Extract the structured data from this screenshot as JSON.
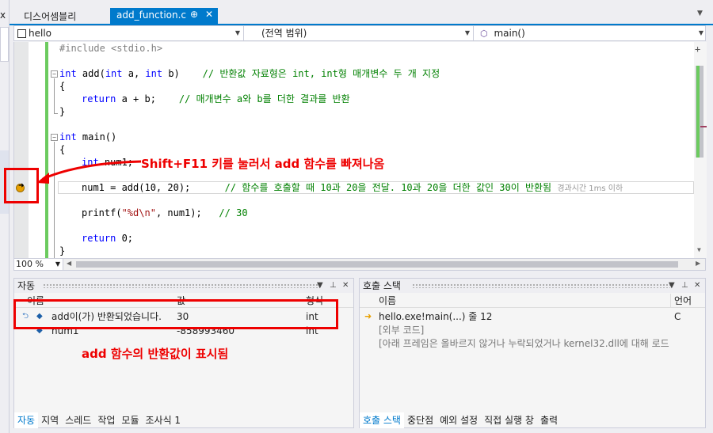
{
  "tabs": {
    "disassembly": "디스어셈블리",
    "active": "add_function.c",
    "pin_glyph": "⊕",
    "close_glyph": "✕"
  },
  "navbar": {
    "project": "hello",
    "scope": "(전역 범위)",
    "function": "main()"
  },
  "code": {
    "l1": "#include <stdio.h>",
    "l3a": "int",
    "l3b": " add(",
    "l3c": "int",
    "l3d": " a, ",
    "l3e": "int",
    "l3f": " b)    ",
    "l3g": "// 반환값 자료형은 int, int형 매개변수 두 개 지정",
    "l4": "{",
    "l5a": "return",
    "l5b": " a + b;    ",
    "l5c": "// 매개변수 a와 b를 더한 결과를 반환",
    "l6": "}",
    "l8a": "int",
    "l8b": " main()",
    "l9": "{",
    "l10a": "int",
    "l10b": " num1;",
    "l12a": "num1 = add(10, 20);      ",
    "l12b": "// 함수를 호출할 때 10과 20을 전달. 10과 20을 더한 값인 30이 반환됨",
    "l12hint": "경과시간 1ms 이하",
    "l14a": "printf(",
    "l14b": "\"%d\\n\"",
    "l14c": ", num1);   ",
    "l14d": "// 30",
    "l16a": "return",
    "l16b": " 0;",
    "l17": "}"
  },
  "editor_status": {
    "zoom": "100 %"
  },
  "autos": {
    "title": "자동",
    "columns": {
      "name": "이름",
      "value": "값",
      "type": "형식"
    },
    "rows": [
      {
        "name": "add이(가) 반환되었습니다.",
        "value": "30",
        "type": "int"
      },
      {
        "name": "num1",
        "value": "-858993460",
        "type": "int"
      }
    ],
    "tabs": [
      "자동",
      "지역",
      "스레드",
      "작업",
      "모듈",
      "조사식 1"
    ]
  },
  "callstack": {
    "title": "호출 스택",
    "columns": {
      "name": "이름",
      "lang": "언어"
    },
    "rows": [
      {
        "name": "hello.exe!main(...) 줄 12",
        "lang": "C"
      },
      {
        "name": "[외부 코드]",
        "lang": ""
      },
      {
        "name": "[아래 프레임은 올바르지 않거나 누락되었거나 kernel32.dll에 대해 로드",
        "lang": ""
      }
    ],
    "tabs": [
      "호출 스택",
      "중단점",
      "예외 설정",
      "직접 실행 창",
      "출력"
    ]
  },
  "annotations": {
    "shift_f11": "Shift+F11 키를 눌러서 add 함수를 빠져나옴",
    "return_value": "add 함수의 반환값이 표시됨"
  },
  "colors": {
    "accent": "#007acc",
    "annotation": "#e00000",
    "changed_bar": "#6ccb5f"
  }
}
